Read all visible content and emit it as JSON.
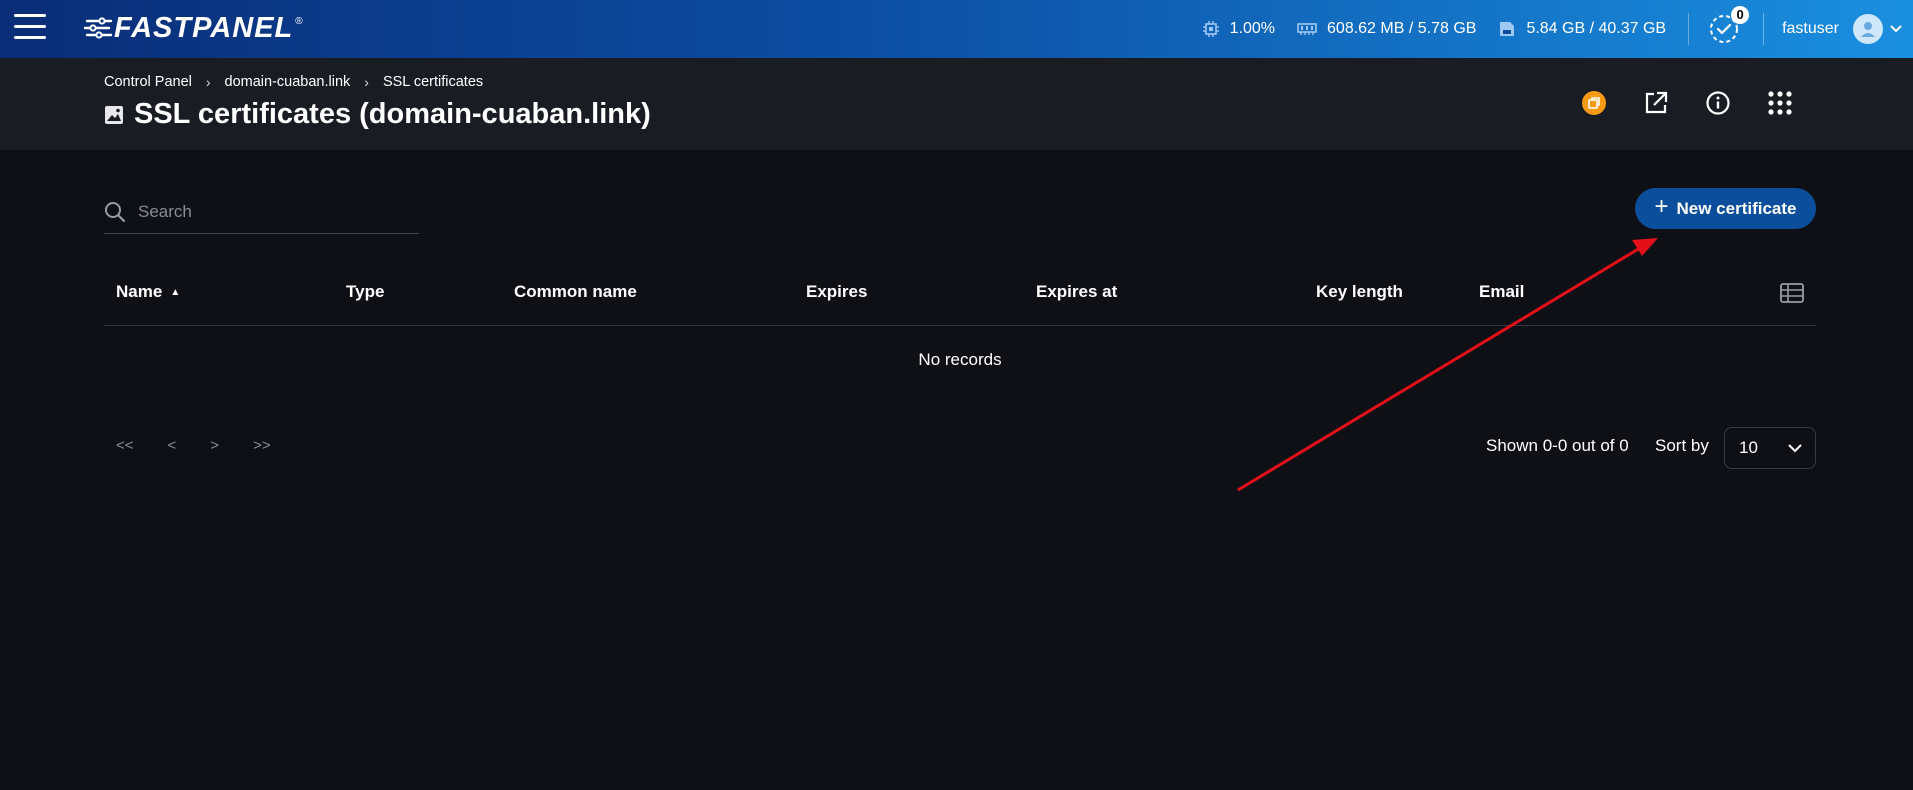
{
  "topbar": {
    "logo": "FASTPANEL",
    "logo_mark": "®",
    "cpu": "1.00%",
    "ram": "608.62 MB / 5.78 GB",
    "disk": "5.84 GB / 40.37 GB",
    "tasks_count": "0",
    "username": "fastuser"
  },
  "breadcrumb": {
    "items": [
      "Control Panel",
      "domain-cuaban.link",
      "SSL certificates"
    ],
    "separator": "›"
  },
  "page": {
    "title": "SSL certificates (domain-cuaban.link)"
  },
  "toolbar": {
    "search_placeholder": "Search",
    "new_button_label": "New certificate"
  },
  "table": {
    "columns": [
      "Name",
      "Type",
      "Common name",
      "Expires",
      "Expires at",
      "Key length",
      "Email"
    ],
    "sorted_column": "Name",
    "sort_direction": "asc",
    "empty_text": "No records"
  },
  "pagination": {
    "first": "<<",
    "prev": "<",
    "next": ">",
    "last": ">>",
    "shown_text": "Shown 0-0 out of 0",
    "sort_by_label": "Sort by",
    "page_size": "10"
  },
  "colors": {
    "accent": "#0b4e9b",
    "badge_orange": "#f59a12",
    "annotation_arrow": "#e3101a"
  }
}
